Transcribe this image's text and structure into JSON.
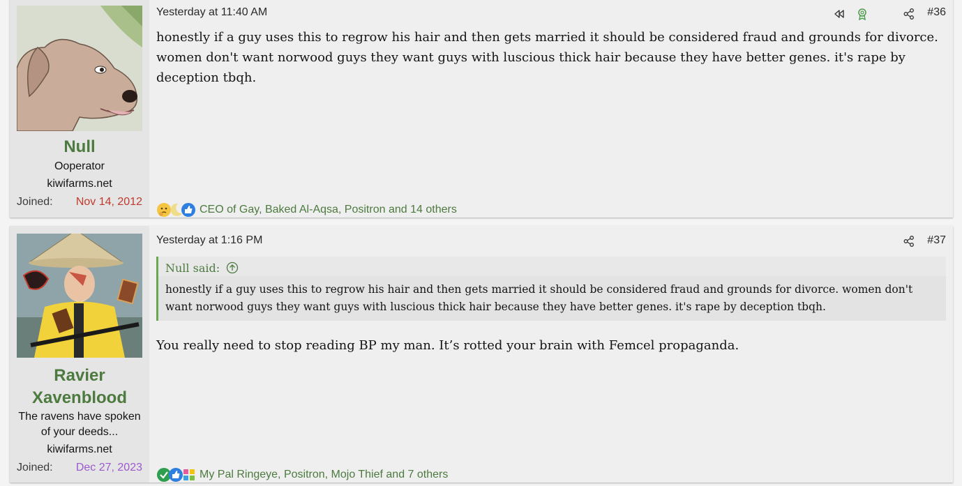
{
  "posts": [
    {
      "date": "Yesterday at 11:40 AM",
      "number": "#36",
      "user": {
        "name": "Null",
        "title": "Ooperator",
        "site": "kiwifarms.net",
        "joined_label": "Joined:",
        "joined_date": "Nov 14, 2012"
      },
      "body": "honestly if a guy uses this to regrow his hair and then gets married it should be considered fraud and grounds for divorce. women don't want norwood guys they want guys with luscious thick hair because they have better genes. it's rape by deception tbqh.",
      "reactions": {
        "icons": [
          "thinking-emoji",
          "moon-icon",
          "thumbs-up-icon"
        ],
        "names": [
          "CEO of Gay",
          "Baked Al-Aqsa",
          "Positron"
        ],
        "others": "14 others"
      }
    },
    {
      "date": "Yesterday at 1:16 PM",
      "number": "#37",
      "user": {
        "name": "Ravier Xavenblood",
        "title": "The ravens have spoken of your deeds...",
        "site": "kiwifarms.net",
        "joined_label": "Joined:",
        "joined_date": "Dec 27, 2023"
      },
      "quote": {
        "author": "Null said:",
        "text": "honestly if a guy uses this to regrow his hair and then gets married it should be considered fraud and grounds for divorce. women don't want norwood guys they want guys with luscious thick hair because they have better genes. it's rape by deception tbqh."
      },
      "body": "You really need to stop reading BP my man. It’s rotted your brain with Femcel propaganda.",
      "reactions": {
        "icons": [
          "check-icon",
          "thumbs-up-icon",
          "puzzle-icon"
        ],
        "names": [
          "My Pal Ringeye",
          "Positron",
          "Mojo Thief"
        ],
        "others": "7 others"
      }
    }
  ],
  "colors": {
    "username": "#4c7a3f",
    "joined_date_1": "#c0392b",
    "joined_date_2": "#9b59d0",
    "quote_border": "#6aa84f"
  },
  "conjunction": "and"
}
